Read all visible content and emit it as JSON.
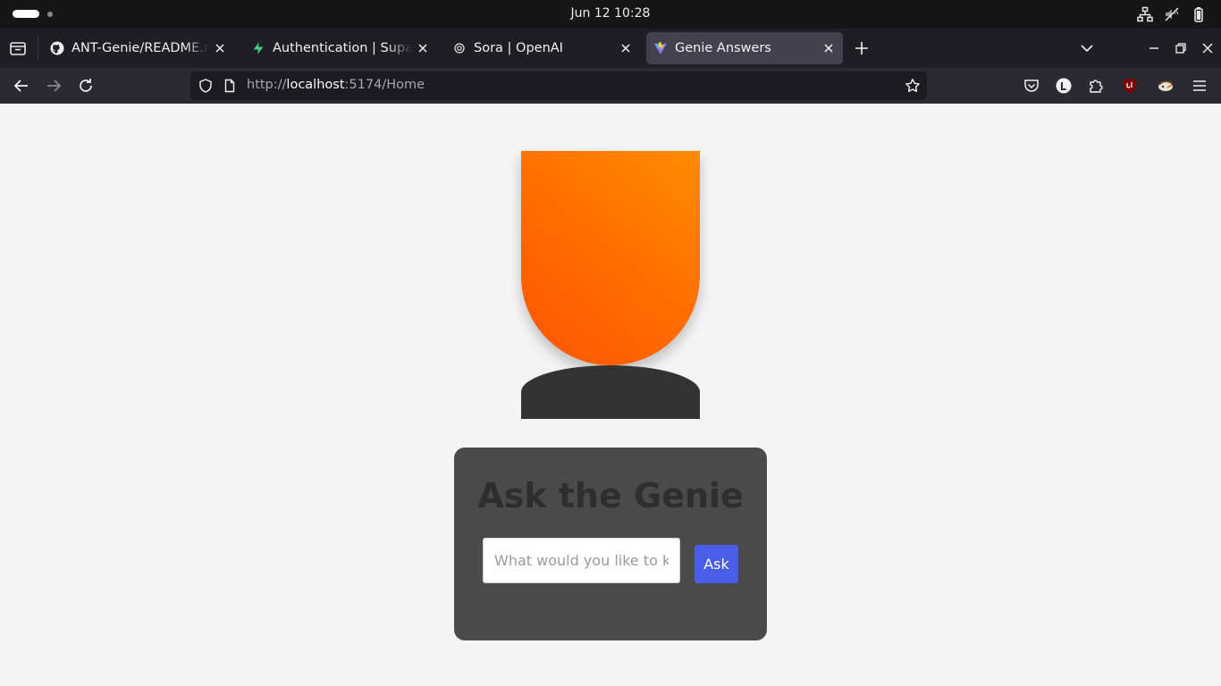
{
  "system_bar": {
    "clock": "Jun 12  10:28",
    "tray_icons": [
      "network-icon",
      "volume-muted-icon",
      "battery-icon"
    ]
  },
  "browser": {
    "tabs": [
      {
        "title": "ANT-Genie/README.md at",
        "favicon": "github-icon",
        "active": false
      },
      {
        "title": "Authentication | Supabase",
        "favicon": "supabase-icon",
        "active": false
      },
      {
        "title": "Sora | OpenAI",
        "favicon": "openai-icon",
        "active": false
      },
      {
        "title": "Genie Answers",
        "favicon": "vite-icon",
        "active": true
      }
    ],
    "url": {
      "scheme": "http://",
      "host": "localhost",
      "rest": ":5174/Home"
    },
    "toolbar_icons": [
      "pocket-icon",
      "account-icon",
      "extensions-icon",
      "ublock-icon",
      "extension-bird-icon",
      "menu-icon"
    ]
  },
  "page": {
    "card": {
      "title": "Ask the Genie",
      "input_placeholder": "What would you like to know?",
      "input_value": "",
      "ask_label": "Ask"
    },
    "colors": {
      "lamp_top": "#ff8c00",
      "lamp_bottom": "#ff5500",
      "base": "#333333",
      "card": "#4a4a4a",
      "button": "#4a5de8"
    }
  }
}
